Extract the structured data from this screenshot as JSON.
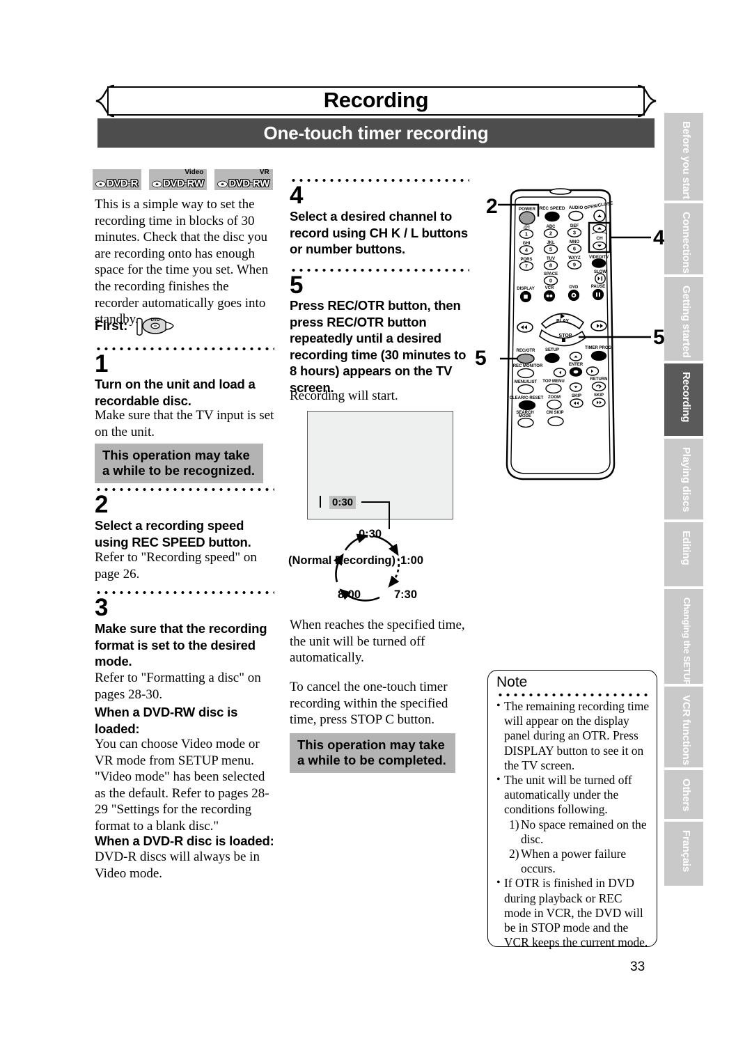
{
  "header": {
    "chapter_title": "Recording",
    "section_title": "One-touch timer recording"
  },
  "page_number": "33",
  "disc_logos": [
    {
      "top": "",
      "name": "DVD-R"
    },
    {
      "top": "Video",
      "name": "DVD-RW"
    },
    {
      "top": "VR",
      "name": "DVD-RW"
    }
  ],
  "intro": {
    "paragraph": "This is a simple way to set the recording time in blocks of 30 minutes. Check that the disc you are recording onto has enough space for the time you set. When the recording finishes the recorder automatically goes into standby.",
    "first_label": "First:"
  },
  "steps": [
    {
      "number": "1",
      "lead": "Turn on the unit and load a recordable disc.",
      "body": "Make sure that the TV input is set on the unit.",
      "notice": "This operation may take a while to be recognized."
    },
    {
      "number": "2",
      "lead": "Select a recording speed using REC SPEED button.",
      "body": "Refer to \"Recording speed\" on page 26."
    },
    {
      "number": "3",
      "lead": "Make sure that the recording format is set to the desired mode.",
      "body": "Refer to \"Formatting a disc\" on pages 28-30.",
      "sub": [
        {
          "lead": "When a DVD-RW disc is loaded:",
          "body": "You can choose Video mode or VR mode from SETUP menu. \"Video mode\" has been selected as the default. Refer to pages 28-29 \"Settings for the recording format to a blank disc.\""
        },
        {
          "lead": "When a DVD-R disc is loaded:",
          "body": "DVD-R discs will always be in Video mode."
        }
      ]
    },
    {
      "number": "4",
      "lead": "Select a desired channel to record using CH K / L buttons or number buttons."
    },
    {
      "number": "5",
      "lead": "Press REC/OTR button, then press REC/OTR button repeatedly until a desired recording time (30 minutes to 8 hours) appears on the TV screen.",
      "body": "Recording will start."
    }
  ],
  "tv_screen": {
    "time_value": "0:30"
  },
  "cycle_diagram": {
    "top": "0:30",
    "right": "1:00",
    "bottom_right": "7:30",
    "bottom_left": "8:00",
    "left": "(Normal Recording)"
  },
  "middle_notes": {
    "auto_off": "When reaches the specified time, the unit will be turned off automatically.",
    "cancel": "To cancel the one-touch timer recording within the specified time, press STOP C button.",
    "notice": "This operation may take a while to be completed."
  },
  "note_box": {
    "title": "Note",
    "bullets": [
      "The remaining recording time will appear on the display panel during an OTR. Press DISPLAY button to see it on the TV screen.",
      "The unit will be turned off automatically under the conditions following.",
      "If OTR is finished in DVD during playback or REC mode in VCR, the DVD will be in STOP mode and the VCR keeps the current mode."
    ],
    "numbered": [
      {
        "n": "1)",
        "text": "No space remained on the disc."
      },
      {
        "n": "2)",
        "text": "When a power failure occurs."
      }
    ]
  },
  "side_tabs": [
    {
      "label": "Before you start",
      "active": false
    },
    {
      "label": "Connections",
      "active": false
    },
    {
      "label": "Getting started",
      "active": false
    },
    {
      "label": "Recording",
      "active": true
    },
    {
      "label": "Playing discs",
      "active": false
    },
    {
      "label": "Editing",
      "active": false
    },
    {
      "label": "Changing the SETUP menu",
      "active": false
    },
    {
      "label": "VCR functions",
      "active": false
    },
    {
      "label": "Others",
      "active": false
    },
    {
      "label": "Français",
      "active": false
    }
  ],
  "remote": {
    "callouts": [
      "2",
      "4",
      "5",
      "5"
    ],
    "buttons_row1": [
      "POWER",
      "REC SPEED",
      "AUDIO",
      "OPEN/CLOSE"
    ],
    "keypad": [
      {
        "top": ".@/:",
        "num": "1"
      },
      {
        "top": "ABC",
        "num": "2"
      },
      {
        "top": "DEF",
        "num": "3"
      },
      {
        "top": "GHI",
        "num": "4"
      },
      {
        "top": "JKL",
        "num": "5"
      },
      {
        "top": "MNO",
        "num": "6"
      },
      {
        "top": "PQRS",
        "num": "7"
      },
      {
        "top": "TUV",
        "num": "8"
      },
      {
        "top": "WXYZ",
        "num": "9"
      },
      {
        "top": "SPACE",
        "num": "0"
      }
    ],
    "ch_label": "CH",
    "video_tv": "VIDEO/TV",
    "slow": "SLOW",
    "display": "DISPLAY",
    "vcr": "VCR",
    "dvd": "DVD",
    "pause": "PAUSE",
    "play": "PLAY",
    "stop": "STOP",
    "rec_otr": "REC/OTR",
    "setup": "SETUP",
    "timer_prog": "TIMER PROG.",
    "rec_monitor": "REC MONITOR",
    "enter": "ENTER",
    "menu_list": "MENU/LIST",
    "top_menu": "TOP MENU",
    "return": "RETURN",
    "clear": "CLEAR/C-RESET",
    "zoom": "ZOOM",
    "skip1": "SKIP",
    "skip2": "SKIP",
    "search_mode": "SEARCH MODE",
    "cm_skip": "CM SKIP"
  }
}
